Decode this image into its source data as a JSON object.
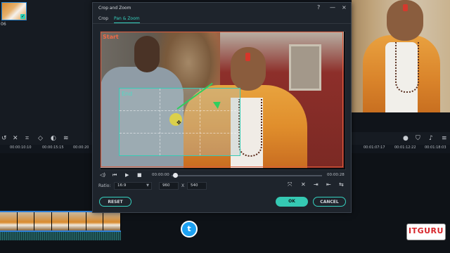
{
  "library": {
    "clip_label": "06"
  },
  "timeline": {
    "timecodes": [
      "00:00:10:10",
      "00:00:15:15",
      "00:00:20",
      "00:01:07:17",
      "00:01:12:22",
      "00:01:18:03"
    ]
  },
  "dialog": {
    "title": "Crop and Zoom",
    "help_icon": "?",
    "close_icon": "×",
    "minimize_icon": "—",
    "tabs": [
      {
        "label": "Crop",
        "active": false
      },
      {
        "label": "Pan & Zoom",
        "active": true
      }
    ],
    "viewer": {
      "start_label": "Start",
      "end_label": "End"
    },
    "playback": {
      "current_time": "00:00:00",
      "end_time": "00:00:28",
      "progress": 0.0
    },
    "ratio": {
      "label": "Ratio:",
      "value": "16:9",
      "width": "960",
      "separator": "X",
      "height": "540"
    },
    "buttons": {
      "reset": "RESET",
      "ok": "OK",
      "cancel": "CANCEL"
    }
  },
  "branding": {
    "logo_text": "ITGURU",
    "accent": "#36d1bf",
    "start_color": "#ef6a47",
    "arrow_color": "#2fcf5e"
  }
}
